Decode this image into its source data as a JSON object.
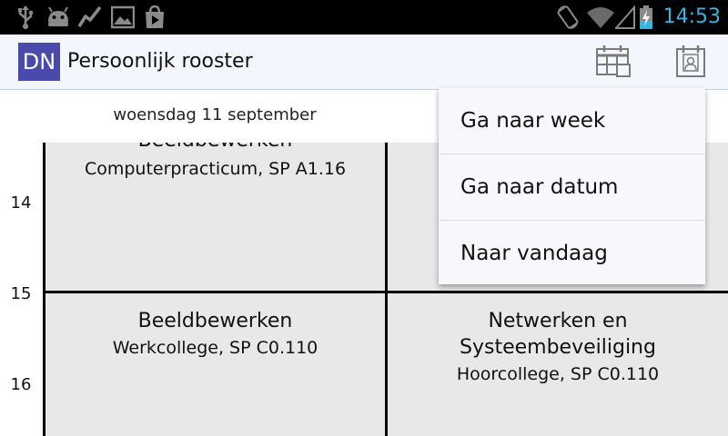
{
  "status_bar": {
    "time": "14:53",
    "accent_color": "#33b5e5",
    "left_icons": [
      "usb-icon",
      "android-icon",
      "chart-icon",
      "image-icon",
      "play-store-icon"
    ],
    "right_icons": [
      "rotate-icon",
      "wifi-icon",
      "signal-icon",
      "battery-charging-icon"
    ]
  },
  "action_bar": {
    "logo_text": "DN",
    "logo_color": "#4a4aac",
    "title": "Persoonlijk rooster",
    "buttons": [
      "calendar-grid-icon",
      "calendar-person-icon"
    ]
  },
  "schedule": {
    "date_label": "woensdag 11 september",
    "hours": [
      "14",
      "15",
      "16"
    ],
    "events": [
      {
        "title": "Beeldbewerken",
        "subtitle": "Computerpracticum, SP A1.16"
      },
      {
        "title": "Beeldbewerken",
        "subtitle": "Werkcollege, SP C0.110"
      },
      {
        "title_line1": "Netwerken en",
        "title_line2": "Systeembeveiliging",
        "subtitle": "Hoorcollege, SP C0.110"
      }
    ]
  },
  "overflow_menu": {
    "items": [
      "Ga naar week",
      "Ga naar datum",
      "Naar vandaag"
    ]
  }
}
